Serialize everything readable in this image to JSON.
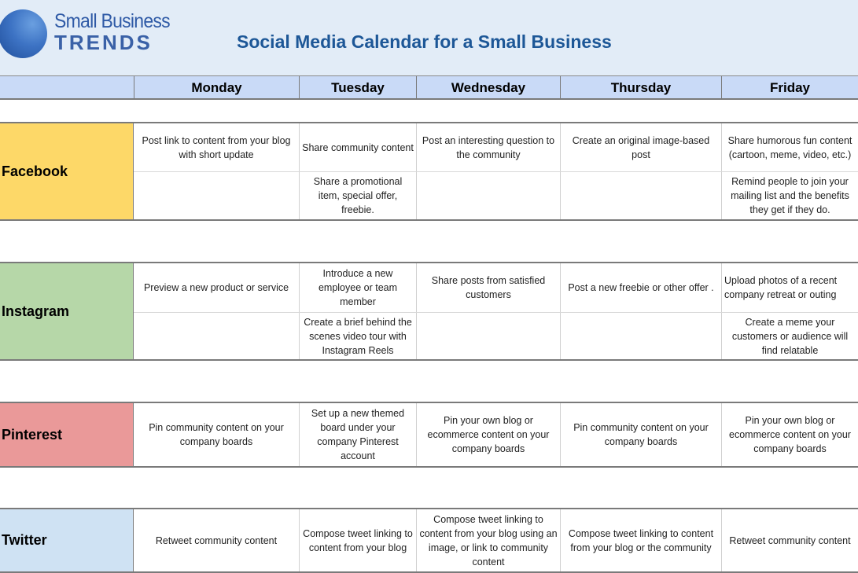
{
  "brand": {
    "logo_line1": "Small Business",
    "logo_line2": "TRENDS"
  },
  "title": "Social Media Calendar for a Small Business",
  "days": [
    "Monday",
    "Tuesday",
    "Wednesday",
    "Thursday",
    "Friday"
  ],
  "colors": {
    "facebook": "#fdd868",
    "instagram": "#b6d7a8",
    "pinterest": "#ea9999",
    "twitter": "#cfe2f3",
    "header": "#c9daf7",
    "title": "#1d5797"
  },
  "platforms": [
    {
      "name": "Facebook",
      "rows": [
        [
          "Post link to content from your blog with short update",
          "Share community content",
          "Post an interesting question to the community",
          "Create an original image-based post",
          "Share humorous fun content (cartoon, meme, video, etc.)"
        ],
        [
          "",
          "Share a promotional item, special offer, freebie.",
          "",
          "",
          "Remind people to join your mailing list and the benefits they get if they do."
        ]
      ]
    },
    {
      "name": "Instagram",
      "rows": [
        [
          "Preview a new product or service",
          "Introduce a new employee or team member",
          "Share posts from satisfied customers",
          "Post a new freebie or other offer .",
          "Upload photos of a recent company retreat or outing"
        ],
        [
          "",
          "Create a brief behind the scenes video tour with Instagram Reels",
          "",
          "",
          "Create a meme your customers or audience will find relatable"
        ]
      ]
    },
    {
      "name": "Pinterest",
      "rows": [
        [
          "Pin community content on your company boards",
          "Set up a new themed board under your company Pinterest account",
          "Pin your own blog or ecommerce content on your company boards",
          "Pin community content on your company boards",
          "Pin your own blog or ecommerce content on your company boards"
        ]
      ]
    },
    {
      "name": "Twitter",
      "rows": [
        [
          "Retweet community content",
          "Compose tweet linking to content from your blog",
          "Compose tweet linking to content from your blog using an image, or link to community content",
          "Compose tweet linking to content from your blog or the community",
          "Retweet community content"
        ]
      ]
    }
  ]
}
